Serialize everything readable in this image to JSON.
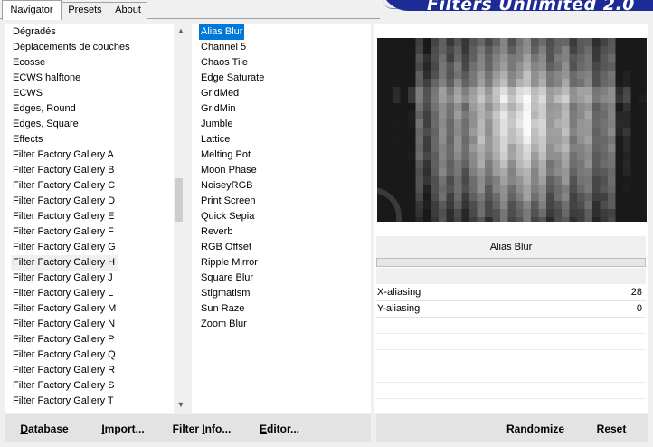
{
  "tabs": [
    {
      "label": "Navigator",
      "active": true
    },
    {
      "label": "Presets",
      "active": false
    },
    {
      "label": "About",
      "active": false
    }
  ],
  "brand": "Filters Unlimited 2.0",
  "categories": [
    "Dégradés",
    "Déplacements de couches",
    "Ecosse",
    "ECWS halftone",
    "ECWS",
    "Edges, Round",
    "Edges, Square",
    "Effects",
    "Filter Factory Gallery A",
    "Filter Factory Gallery B",
    "Filter Factory Gallery C",
    "Filter Factory Gallery D",
    "Filter Factory Gallery E",
    "Filter Factory Gallery F",
    "Filter Factory Gallery G",
    "Filter Factory Gallery H",
    "Filter Factory Gallery J",
    "Filter Factory Gallery L",
    "Filter Factory Gallery M",
    "Filter Factory Gallery N",
    "Filter Factory Gallery P",
    "Filter Factory Gallery Q",
    "Filter Factory Gallery R",
    "Filter Factory Gallery S",
    "Filter Factory Gallery T"
  ],
  "selected_category": "Filter Factory Gallery H",
  "filters": [
    "Alias Blur",
    "Channel 5",
    "Chaos Tile",
    "Edge Saturate",
    "GridMed",
    "GridMin",
    "Jumble",
    "Lattice",
    "Melting Pot",
    "Moon Phase",
    "NoiseyRGB",
    "Print Screen",
    "Quick Sepia",
    "Reverb",
    "RGB Offset",
    "Ripple Mirror",
    "Square Blur",
    "Stigmatism",
    "Sun Raze",
    "Zoom Blur"
  ],
  "selected_filter": "Alias Blur",
  "filter_title": "Alias Blur",
  "parameters": [
    {
      "name": "X-aliasing",
      "value": "28"
    },
    {
      "name": "Y-aliasing",
      "value": "0"
    }
  ],
  "buttons": {
    "database": {
      "label": "Database",
      "mnemonic": "D",
      "rest": "atabase"
    },
    "import": {
      "label": "Import...",
      "mnemonic": "I",
      "rest": "mport..."
    },
    "filter_info": {
      "label": "Filter Info...",
      "pre": "Filter ",
      "mnemonic": "I",
      "rest": "nfo..."
    },
    "editor": {
      "label": "Editor...",
      "mnemonic": "E",
      "rest": "ditor..."
    },
    "randomize": {
      "label": "Randomize"
    },
    "reset": {
      "label": "Reset"
    }
  },
  "colors": {
    "selection": "#0078d7",
    "brand_bg": "#1d2b97",
    "window_bg": "#f0f0f0"
  },
  "icons": {
    "scroll_up": "▲",
    "scroll_down": "▼"
  }
}
